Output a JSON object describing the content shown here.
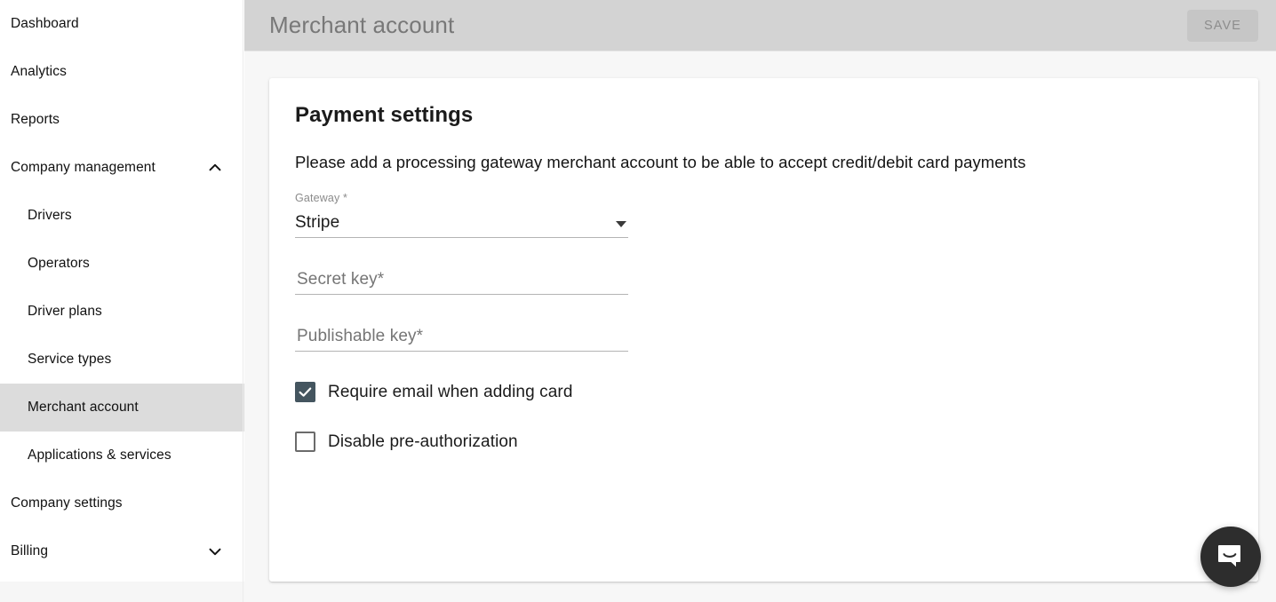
{
  "sidebar": {
    "items": [
      {
        "label": "Dashboard",
        "level": 1,
        "active": false,
        "chevron": "none"
      },
      {
        "label": "Analytics",
        "level": 1,
        "active": false,
        "chevron": "none"
      },
      {
        "label": "Reports",
        "level": 1,
        "active": false,
        "chevron": "none"
      },
      {
        "label": "Company management",
        "level": 1,
        "active": false,
        "chevron": "up"
      },
      {
        "label": "Drivers",
        "level": 2,
        "active": false,
        "chevron": "none"
      },
      {
        "label": "Operators",
        "level": 2,
        "active": false,
        "chevron": "none"
      },
      {
        "label": "Driver plans",
        "level": 2,
        "active": false,
        "chevron": "none"
      },
      {
        "label": "Service types",
        "level": 2,
        "active": false,
        "chevron": "none"
      },
      {
        "label": "Merchant account",
        "level": 2,
        "active": true,
        "chevron": "none"
      },
      {
        "label": "Applications & services",
        "level": 2,
        "active": false,
        "chevron": "none"
      },
      {
        "label": "Company settings",
        "level": 1,
        "active": false,
        "chevron": "none"
      },
      {
        "label": "Billing",
        "level": 1,
        "active": false,
        "chevron": "down"
      }
    ]
  },
  "topbar": {
    "title": "Merchant account",
    "save_label": "SAVE"
  },
  "card": {
    "title": "Payment settings",
    "subtitle": "Please add a processing gateway merchant account to be able to accept credit/debit card payments",
    "fields": [
      {
        "name": "gateway",
        "label": "Gateway *",
        "value": "Stripe",
        "placeholder": "",
        "type": "select",
        "options": [
          "Stripe"
        ]
      },
      {
        "name": "secret-key",
        "label": "",
        "value": "",
        "placeholder": "Secret key*",
        "type": "text"
      },
      {
        "name": "publishable-key",
        "label": "",
        "value": "",
        "placeholder": "Publishable key*",
        "type": "text"
      }
    ],
    "checkboxes": [
      {
        "name": "require-email-when-adding-card",
        "label": "Require email when adding card",
        "checked": true
      },
      {
        "name": "disable-pre-authorization",
        "label": "Disable pre-authorization",
        "checked": false
      }
    ]
  },
  "chat": {
    "icon": "chat-bubble-smile-icon"
  },
  "colors": {
    "checkbox_checked": "#44555f",
    "topbar_bg": "#d3d3d3",
    "sidebar_active_bg": "#dcdcdc",
    "chat_bg": "#2d2d2d"
  }
}
